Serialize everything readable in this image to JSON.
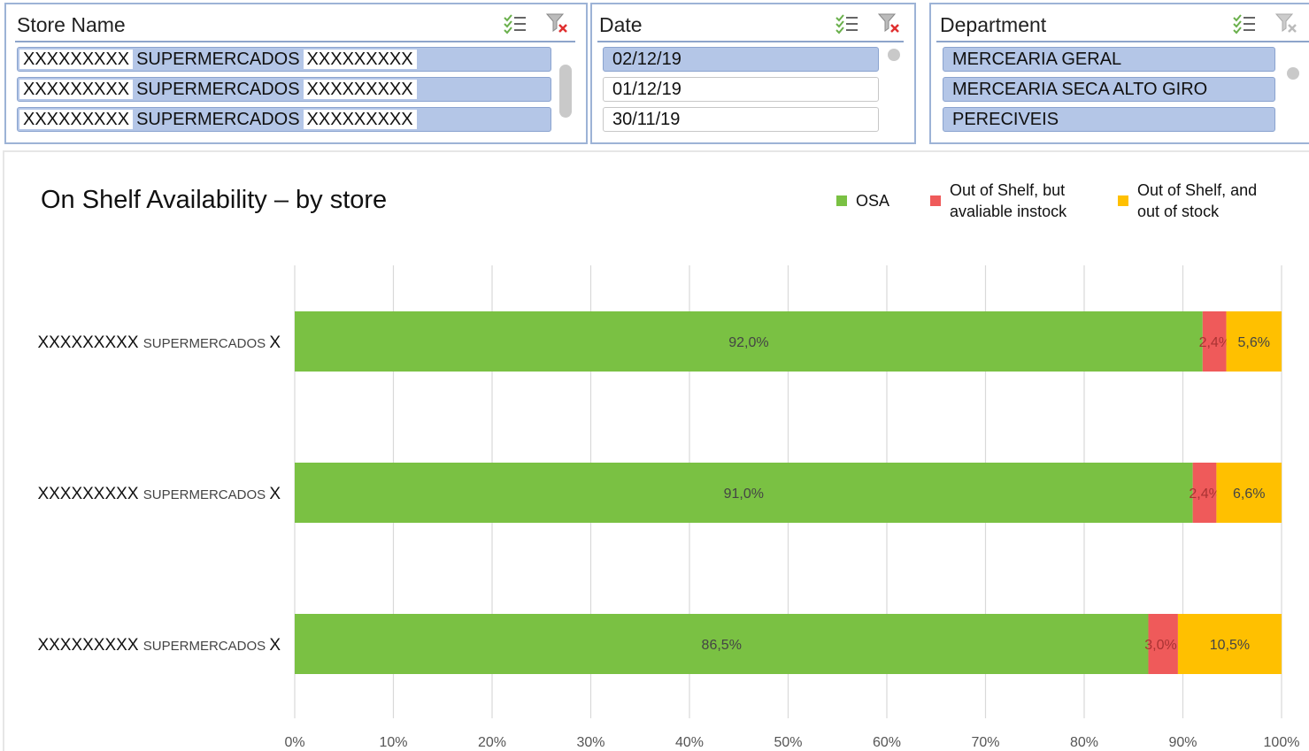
{
  "slicers": {
    "store": {
      "title": "Store Name",
      "items": [
        {
          "prefix": "XXXXXXXXX",
          "mid": "SUPERMERCADOS",
          "suffix": "XXXXXXXXX",
          "selected": true
        },
        {
          "prefix": "XXXXXXXXX",
          "mid": "SUPERMERCADOS",
          "suffix": "XXXXXXXXX",
          "selected": true
        },
        {
          "prefix": "XXXXXXXXX",
          "mid": "SUPERMERCADOS",
          "suffix": "XXXXXXXXX",
          "selected": true
        }
      ]
    },
    "date": {
      "title": "Date",
      "items": [
        {
          "label": "02/12/19",
          "selected": true
        },
        {
          "label": "01/12/19",
          "selected": false
        },
        {
          "label": "30/11/19",
          "selected": false
        }
      ]
    },
    "department": {
      "title": "Department",
      "items": [
        {
          "label": "MERCEARIA GERAL",
          "selected": true
        },
        {
          "label": "MERCEARIA SECA ALTO GIRO",
          "selected": true
        },
        {
          "label": "PERECIVEIS",
          "selected": true
        }
      ]
    },
    "icons": [
      "multi-select-icon",
      "clear-filter-icon"
    ]
  },
  "chart_data": {
    "type": "bar",
    "orientation": "horizontal",
    "stacked": true,
    "title": "On Shelf Availability – by store",
    "categories": [
      {
        "bold": "XXXXXXXXX",
        "small": "SUPERMERCADOS",
        "tail": "X"
      },
      {
        "bold": "XXXXXXXXX",
        "small": "SUPERMERCADOS",
        "tail": "X"
      },
      {
        "bold": "XXXXXXXXX",
        "small": "SUPERMERCADOS",
        "tail": "X"
      }
    ],
    "series": [
      {
        "name": "OSA",
        "color": "#7ac143",
        "values": [
          92.0,
          91.0,
          86.5
        ],
        "labels": [
          "92,0%",
          "91,0%",
          "86,5%"
        ]
      },
      {
        "name": "Out of Shelf, but avaliable instock",
        "color": "#ef5a5a",
        "values": [
          2.4,
          2.4,
          3.0
        ],
        "labels": [
          "2,4%",
          "2,4%",
          "3,0%"
        ]
      },
      {
        "name": "Out of Shelf, and out of stock",
        "color": "#ffc000",
        "values": [
          5.6,
          6.6,
          10.5
        ],
        "labels": [
          "5,6%",
          "6,6%",
          "10,5%"
        ]
      }
    ],
    "xlim": [
      0,
      100
    ],
    "xticks": [
      "0%",
      "10%",
      "20%",
      "30%",
      "40%",
      "50%",
      "60%",
      "70%",
      "80%",
      "90%",
      "100%"
    ],
    "grid": true,
    "legend": "top-right"
  }
}
